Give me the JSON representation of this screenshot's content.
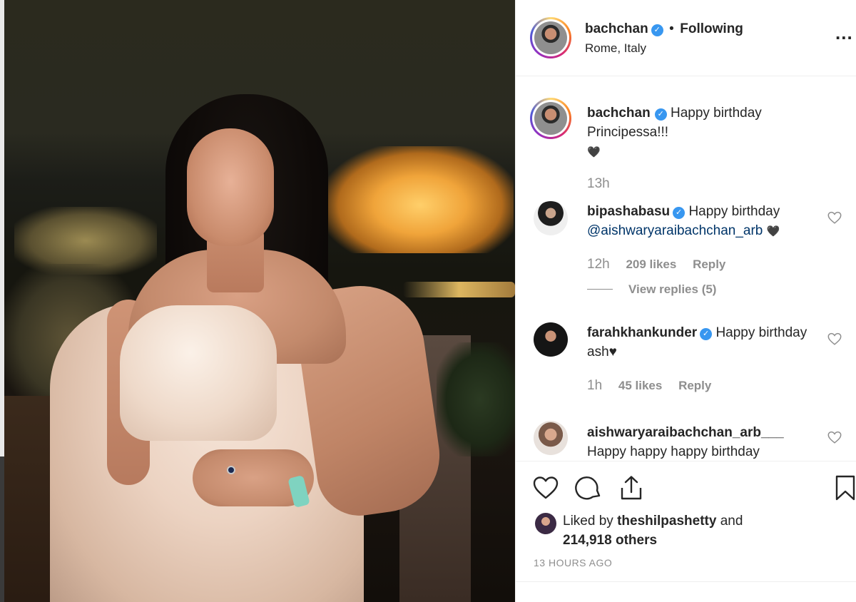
{
  "post": {
    "author": "bachchan",
    "follow_status": "Following",
    "separator": "•",
    "location": "Rome, Italy",
    "verified_glyph": "✓",
    "more_glyph": "..."
  },
  "caption": {
    "username": "bachchan",
    "text": "Happy birthday Principessa!!!",
    "emoji": "🖤",
    "time": "13h"
  },
  "comments": [
    {
      "username": "bipashabasu",
      "verified": true,
      "text_prefix": "Happy birthday",
      "mention": "@aishwaryaraibachchan_arb",
      "text_suffix": "🖤",
      "time": "12h",
      "likes": "209 likes",
      "reply_label": "Reply",
      "view_replies": "View replies (5)"
    },
    {
      "username": "farahkhankunder",
      "verified": true,
      "text": "Happy birthday ash♥",
      "time": "1h",
      "likes": "45 likes",
      "reply_label": "Reply"
    },
    {
      "username": "aishwaryaraibachchan_arb___",
      "verified": false,
      "text": "Happy happy happy birthday"
    }
  ],
  "likes": {
    "prefix": "Liked by",
    "user": "theshilpashetty",
    "conj": "and",
    "count": "214,918 others"
  },
  "timestamp": "13 HOURS AGO",
  "icons": {
    "like": "heart-icon",
    "comment": "comment-icon",
    "share": "share-icon",
    "save": "bookmark-icon",
    "more": "more-options-icon"
  },
  "colors": {
    "verified": "#3897f0",
    "muted": "#8e8e8e",
    "text": "#262626",
    "mention": "#003569"
  }
}
